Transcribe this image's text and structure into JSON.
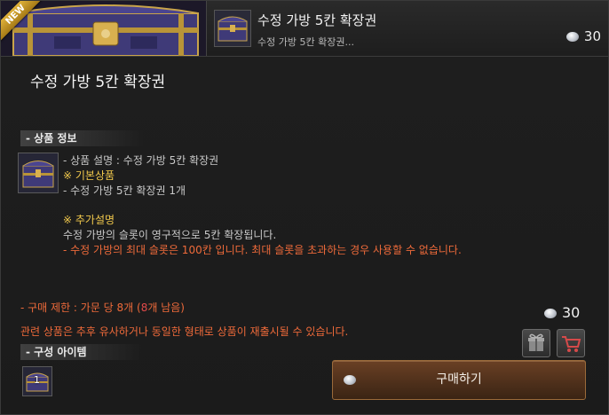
{
  "header": {
    "badge": "NEW",
    "title": "수정 가방 5칸 확장권",
    "subtitle": "수정 가방 5칸 확장권...",
    "price": "30"
  },
  "main": {
    "title": "수정 가방 5칸 확장권"
  },
  "product_info": {
    "section_label": "- 상품 정보",
    "description": "- 상품 설명 : 수정 가방 5칸 확장권",
    "basic_heading": "※ 기본상품",
    "basic_item": "- 수정 가방 5칸 확장권 1개",
    "extra_heading": "※ 추가설명",
    "extra_line1": "수정 가방의 슬롯이 영구적으로 5칸 확장됩니다.",
    "extra_warning": "- 수정 가방의 최대 슬롯은 100칸 입니다. 최대 슬롯을 초과하는 경우 사용할 수 없습니다."
  },
  "purchase": {
    "limit_prefix": "- 구매 제한 : 가문 당 8개 (",
    "limit_remaining": "8",
    "limit_suffix": "개 남음)",
    "notice": "관련 상품은 추후 유사하거나 동일한 형태로 상품이 재출시될 수 있습니다.",
    "price": "30",
    "buy_label": "구매하기"
  },
  "composition": {
    "section_label": "- 구성 아이템",
    "item_count": "1"
  },
  "icons": {
    "gift": "gift-icon",
    "cart": "cart-icon",
    "coin": "silver-coin-icon"
  },
  "colors": {
    "highlight_yellow": "#f2c94c",
    "warning_orange": "#ee6a3a",
    "buy_button": "#5a3620"
  }
}
